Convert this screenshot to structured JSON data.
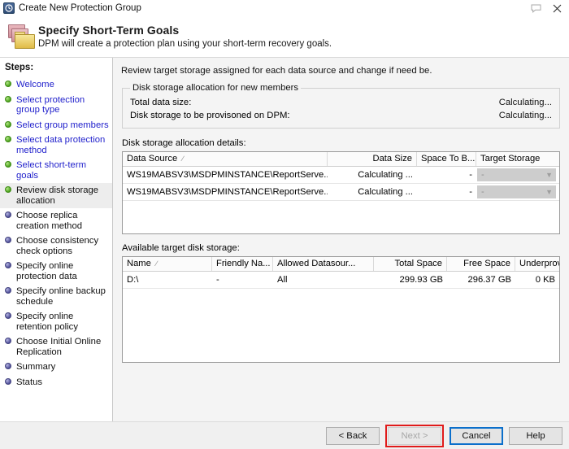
{
  "window": {
    "title": "Create New Protection Group",
    "app_icon": "dpm-clock-icon",
    "feedback_icon": "feedback-comment-icon",
    "close_icon": "close-icon"
  },
  "header": {
    "icon": "folder-stack-icon",
    "title": "Specify Short-Term Goals",
    "subtitle": "DPM will create a protection plan using your short-term recovery goals."
  },
  "sidebar": {
    "label": "Steps:",
    "items": [
      {
        "label": "Welcome",
        "state": "done"
      },
      {
        "label": "Select protection group type",
        "state": "done"
      },
      {
        "label": "Select group members",
        "state": "done"
      },
      {
        "label": "Select data protection method",
        "state": "done"
      },
      {
        "label": "Select short-term goals",
        "state": "done"
      },
      {
        "label": "Review disk storage allocation",
        "state": "current"
      },
      {
        "label": "Choose replica creation method",
        "state": "todo"
      },
      {
        "label": "Choose consistency check options",
        "state": "todo"
      },
      {
        "label": "Specify online protection data",
        "state": "todo"
      },
      {
        "label": "Specify online backup schedule",
        "state": "todo"
      },
      {
        "label": "Specify online retention policy",
        "state": "todo"
      },
      {
        "label": "Choose Initial Online Replication",
        "state": "todo"
      },
      {
        "label": "Summary",
        "state": "todo"
      },
      {
        "label": "Status",
        "state": "todo"
      }
    ]
  },
  "main": {
    "intro": "Review target storage assigned for each data source and change if need be.",
    "allocation_group": {
      "legend": "Disk storage allocation for new members",
      "rows": [
        {
          "label": "Total data size:",
          "value": "Calculating..."
        },
        {
          "label": "Disk storage to be provisoned on DPM:",
          "value": "Calculating..."
        }
      ]
    },
    "details_label": "Disk storage allocation details:",
    "details_grid": {
      "sort_glyph": "∕",
      "columns": [
        "Data Source",
        "Data Size",
        "Space To B...",
        "Target Storage"
      ],
      "rows": [
        {
          "data_source": "WS19MABSV3\\MSDPMINSTANCE\\ReportServe...",
          "data_size": "Calculating ...",
          "space_to_be": "-",
          "target_storage": "-"
        },
        {
          "data_source": "WS19MABSV3\\MSDPMINSTANCE\\ReportServe...",
          "data_size": "Calculating ...",
          "space_to_be": "-",
          "target_storage": "-"
        }
      ]
    },
    "available_label": "Available target disk storage:",
    "available_grid": {
      "sort_glyph": "∕",
      "columns": [
        "Name",
        "Friendly Na...",
        "Allowed Datasour...",
        "Total Space",
        "Free Space",
        "Underprovi..."
      ],
      "rows": [
        {
          "name": "D:\\",
          "friendly_name": "-",
          "allowed_datasources": "All",
          "total_space": "299.93 GB",
          "free_space": "296.37 GB",
          "underprovisioned": "0 KB"
        }
      ]
    }
  },
  "footer": {
    "back": "< Back",
    "next": "Next >",
    "cancel": "Cancel",
    "help": "Help"
  },
  "colors": {
    "link": "#2222cc",
    "highlight_box": "#e01b1b",
    "focus_border": "#0b6fcb",
    "done_bullet": "#4ba21c",
    "todo_bullet": "#4f4f99"
  }
}
